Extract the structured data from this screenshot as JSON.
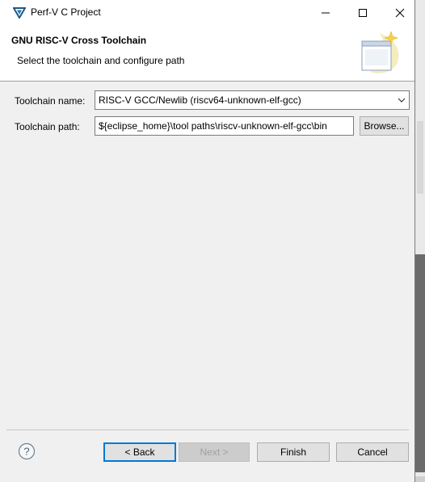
{
  "window": {
    "title": "Perf-V C Project",
    "app_icon": "perf-v-logo-icon",
    "controls": [
      "minimize-icon",
      "maximize-icon",
      "close-icon"
    ]
  },
  "header": {
    "title": "GNU RISC-V Cross Toolchain",
    "description": "Select the toolchain and configure path",
    "image": "wizard-banner-icon"
  },
  "form": {
    "toolchain_name_label": "Toolchain name:",
    "toolchain_name_value": "RISC-V GCC/Newlib (riscv64-unknown-elf-gcc)",
    "toolchain_path_label": "Toolchain path:",
    "toolchain_path_value": "${eclipse_home}\\tool paths\\riscv-unknown-elf-gcc\\bin",
    "browse_label": "Browse..."
  },
  "footer": {
    "help_icon": "help-icon",
    "back_label": "< Back",
    "next_label": "Next >",
    "finish_label": "Finish",
    "cancel_label": "Cancel"
  },
  "colors": {
    "focus_border": "#0078d7",
    "dialog_bg": "#f0f0f0",
    "header_bg": "#ffffff"
  }
}
